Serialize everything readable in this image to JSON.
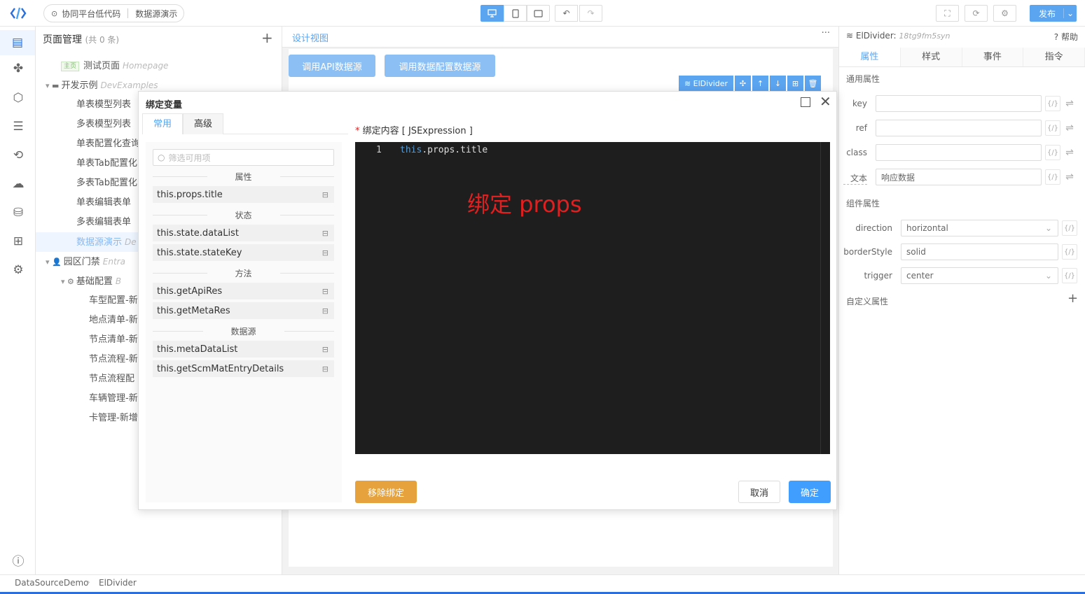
{
  "topbar": {
    "project": "协同平台低代码",
    "page": "数据源演示",
    "publish": "发布"
  },
  "page_panel": {
    "title": "页面管理",
    "count": "(共 0 条)",
    "home_badge": "主页",
    "tree": [
      {
        "label": "测试页面",
        "en": "Homepage",
        "home": true,
        "indent": 1
      },
      {
        "label": "开发示例",
        "en": "DevExamples",
        "indent": 0,
        "folder": true
      },
      {
        "label": "单表模型列表",
        "en": "",
        "indent": 2
      },
      {
        "label": "多表模型列表",
        "en": "",
        "indent": 2
      },
      {
        "label": "单表配置化查询",
        "en": "",
        "indent": 2
      },
      {
        "label": "单表Tab配置化",
        "en": "",
        "indent": 2
      },
      {
        "label": "多表Tab配置化",
        "en": "",
        "indent": 2
      },
      {
        "label": "单表编辑表单",
        "en": "",
        "indent": 2
      },
      {
        "label": "多表编辑表单",
        "en": "",
        "indent": 2
      },
      {
        "label": "数据源演示",
        "en": "De",
        "indent": 2,
        "selected": true
      },
      {
        "label": "园区门禁",
        "en": "Entra",
        "indent": 0,
        "folder": true,
        "user": true
      },
      {
        "label": "基础配置",
        "en": "B",
        "indent": 1,
        "folder": true,
        "gear": true
      },
      {
        "label": "车型配置-新",
        "en": "",
        "indent": 3
      },
      {
        "label": "地点清单-新",
        "en": "",
        "indent": 3
      },
      {
        "label": "节点清单-新",
        "en": "",
        "indent": 3
      },
      {
        "label": "节点流程-新",
        "en": "",
        "indent": 3
      },
      {
        "label": "节点流程配",
        "en": "",
        "indent": 3
      },
      {
        "label": "车辆管理-新",
        "en": "",
        "indent": 3
      },
      {
        "label": "卡管理-新增",
        "en": "",
        "indent": 3
      }
    ]
  },
  "canvas": {
    "tab": "设计视图",
    "more": "···",
    "btn_api": "调用API数据源",
    "btn_meta": "调用数据配置数据源",
    "sel_component": "ElDivider",
    "sel_actions": [
      "✣",
      "↑",
      "↓",
      "⊞",
      "🗑"
    ]
  },
  "right_panel": {
    "component": "ElDivider:",
    "component_id": "18tg9fm5syn",
    "help": "帮助",
    "tabs": [
      "属性",
      "样式",
      "事件",
      "指令"
    ],
    "section_common": "通用属性",
    "common_props": [
      {
        "label": "key",
        "value": ""
      },
      {
        "label": "ref",
        "value": ""
      },
      {
        "label": "class",
        "value": ""
      },
      {
        "label": "文本",
        "value": "响应数据"
      }
    ],
    "section_component": "组件属性",
    "component_props": [
      {
        "label": "direction",
        "value": "horizontal",
        "select": true
      },
      {
        "label": "borderStyle",
        "value": "solid",
        "select": false
      },
      {
        "label": "trigger",
        "value": "center",
        "select": true
      }
    ],
    "section_custom": "自定义属性",
    "expr_icon": "{/}",
    "swap_icon": "⇌"
  },
  "dialog": {
    "title": "绑定变量",
    "tabs": [
      "常用",
      "高级"
    ],
    "search_placeholder": "筛选可用项",
    "groups": [
      {
        "name": "属性",
        "items": [
          "this.props.title"
        ]
      },
      {
        "name": "状态",
        "items": [
          "this.state.dataList",
          "this.state.stateKey"
        ]
      },
      {
        "name": "方法",
        "items": [
          "this.getApiRes",
          "this.getMetaRes"
        ]
      },
      {
        "name": "数据源",
        "items": [
          "this.metaDataList",
          "this.getScmMatEntryDetails"
        ]
      }
    ],
    "content_label": "绑定内容 [ JSExpression ]",
    "required_mark": "*",
    "code_line_no": "1",
    "code_this": "this",
    "code_rest": ".props.title",
    "annotation": "绑定 props",
    "btn_remove": "移除绑定",
    "btn_cancel": "取消",
    "btn_ok": "确定"
  },
  "statusbar": {
    "path": [
      "DataSourceDemo",
      "ElDivider"
    ]
  }
}
